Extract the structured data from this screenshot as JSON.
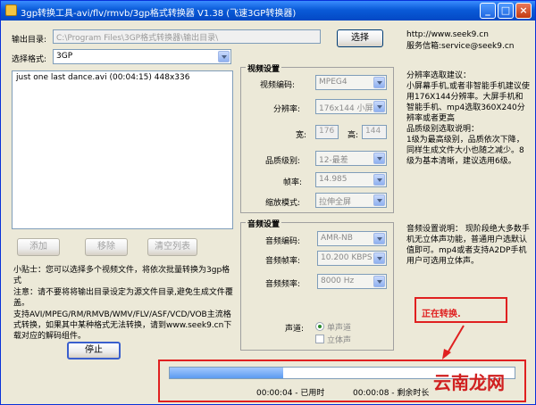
{
  "window": {
    "title": "3gp转换工具-avi/flv/rmvb/3gp格式转换器 V1.38 (飞速3GP转换器)"
  },
  "output": {
    "label": "输出目录:",
    "value": "C:\\Program Files\\3GP格式转换器\\输出目录\\",
    "browse_label": "选择"
  },
  "format": {
    "label": "选择格式:",
    "value": "3GP"
  },
  "site": {
    "url": "http://www.seek9.cn",
    "email": "服务信箱:service@seek9.cn"
  },
  "file_list": {
    "items": [
      "just one last dance.avi (00:04:15) 448x336"
    ]
  },
  "buttons": {
    "add": "添加",
    "remove": "移除",
    "clear": "清空列表",
    "stop": "停止"
  },
  "video": {
    "group_title": "视频设置",
    "codec_label": "视频编码:",
    "codec_value": "MPEG4",
    "resolution_label": "分辨率:",
    "resolution_value": "176x144 小屏",
    "width_label": "宽:",
    "width_value": "176",
    "height_label": "高:",
    "height_value": "144",
    "quality_label": "品质级别:",
    "quality_value": "12-最差",
    "fps_label": "帧率:",
    "fps_value": "14.985",
    "scale_label": "缩放模式:",
    "scale_value": "拉伸全屏"
  },
  "audio": {
    "group_title": "音频设置",
    "codec_label": "音频编码:",
    "codec_value": "AMR-NB",
    "bitrate_label": "音频帧率:",
    "bitrate_value": "10.200 KBPS",
    "samplerate_label": "音频频率:",
    "samplerate_value": "8000 Hz",
    "channel_label": "声道:",
    "mono_label": "单声道",
    "stereo_label": "立体声"
  },
  "tips": {
    "resolution_tip": "分辨率选取建议：\n小屏幕手机,或者非智能手机建议使用176X144分辨率。大屏手机和智能手机、mp4选取360X240分辨率或者更高",
    "quality_tip": "品质级别选取说明：\n1级为最高级别，品质依次下降，同样生成文件大小也随之减少。8级为基本清晰，建议选用6级。",
    "audio_tip": "音频设置说明：  现阶段绝大多数手机无立体声功能，普通用户选默认值即可。mp4或者支持A2DP手机用户可选用立体声。",
    "tip1": "小贴士：您可以选择多个视频文件，将依次批量转换为3gp格式",
    "tip2": "注意：请不要将将输出目录设定为源文件目录,避免生成文件覆盖。",
    "tip3": "支持AVI/MPEG/RM/RMVB/WMV/FLV/ASF/VCD/VOB主流格式转换，如果其中某种格式无法转换，请到www.seek9.cn下载对应的解码组件。"
  },
  "status": {
    "converting": "正在转换.",
    "elapsed": "00:00:04 - 已用时",
    "remaining": "00:00:08 - 剩余时长",
    "progress": 0.33
  },
  "watermark": "云南龙网"
}
